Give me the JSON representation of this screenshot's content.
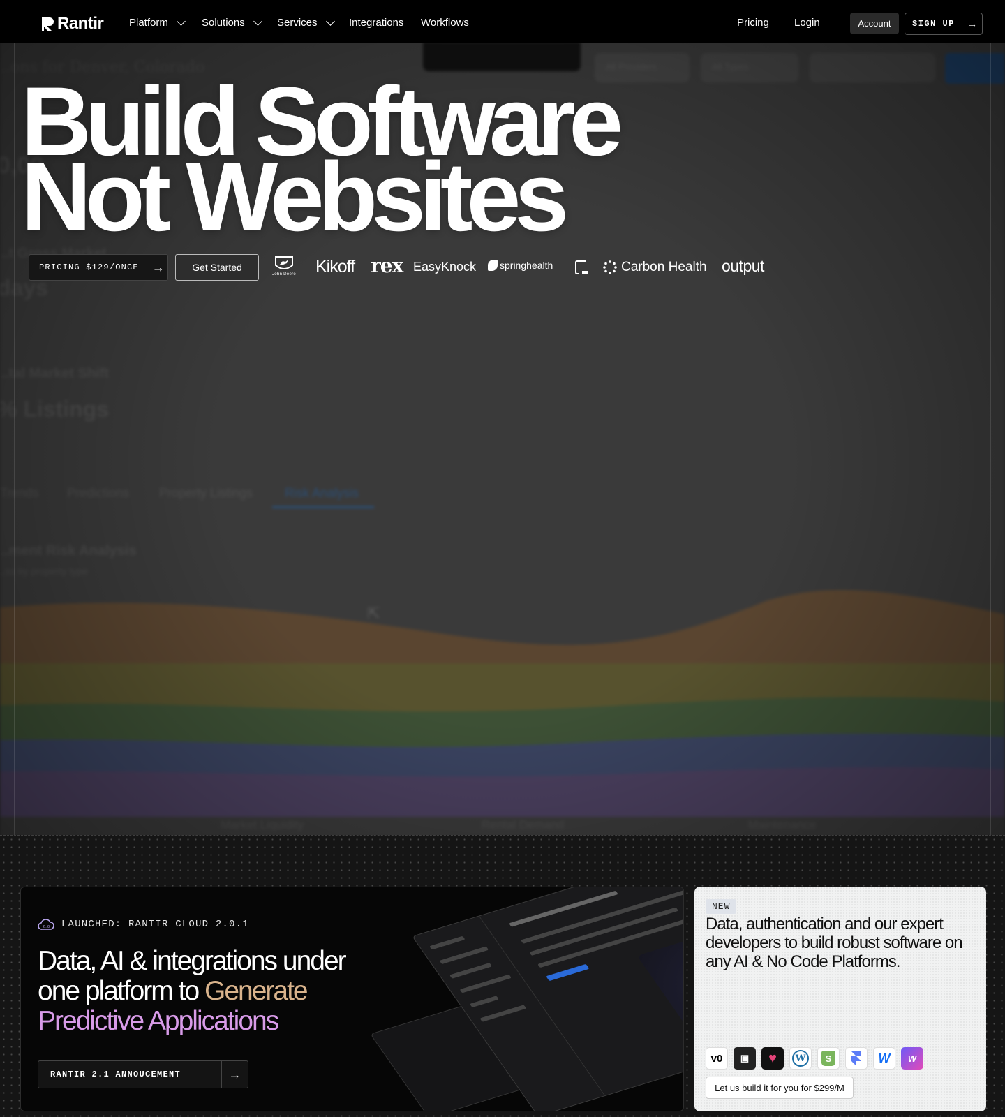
{
  "nav": {
    "logo": "Rantir",
    "items": [
      {
        "label": "Platform",
        "dropdown": true
      },
      {
        "label": "Solutions",
        "dropdown": true
      },
      {
        "label": "Services",
        "dropdown": true
      },
      {
        "label": "Integrations",
        "dropdown": false
      },
      {
        "label": "Workflows",
        "dropdown": false
      }
    ],
    "pricing": "Pricing",
    "login": "Login",
    "account": "Account",
    "signup": "SIGN UP"
  },
  "hero": {
    "line1": "Build Software",
    "line2": "Not Websites",
    "pricing_button": "PRICING $129/ONCE",
    "get_started": "Get Started",
    "clients": [
      "John Deere",
      "Kikoff",
      "rex",
      "EasyKnock",
      "springhealth",
      "Carbon Health",
      "output"
    ]
  },
  "background_dashboard": {
    "title": "...ons for Denver, Colorado",
    "filters": [
      "All Providers",
      "All Types"
    ],
    "big_value": "0,00",
    "metric1_label": "...t Gross Market",
    "metric1_value": "days",
    "metric2_label": "...tal Market Shift",
    "metric2_value": "% Listings",
    "tabs": [
      "Trends",
      "Predictions",
      "Property Listings",
      "Risk Analysis"
    ],
    "active_tab": "Risk Analysis",
    "section_title": "...ment Risk Analysis",
    "section_subtitle": "...ss by property type",
    "axis": [
      "Market Liquidity",
      "Rental Demand",
      "Maintenance"
    ]
  },
  "launch_card": {
    "badge": "LAUNCHED: RANTIR CLOUD 2.0.1",
    "headline_plain": "Data, AI & integrations under one platform to ",
    "headline_gold": "Generate",
    "headline_pink": "Predictive Applications",
    "button": "RANTIR 2.1 ANNOUCEMENT"
  },
  "new_card": {
    "badge": "NEW",
    "description": "Data, authentication and our expert developers to build robust software on any AI & No Code Platforms.",
    "tools": [
      "v0",
      "Bolt",
      "Lovable",
      "WordPress",
      "Shopify",
      "Framer",
      "Webflow",
      "Wized"
    ],
    "button": "Let us build it for you for $299/M"
  },
  "colors": {
    "accent_gold": "#d9b38c",
    "accent_pink": "#d89be8",
    "nav_bg": "#000000"
  }
}
